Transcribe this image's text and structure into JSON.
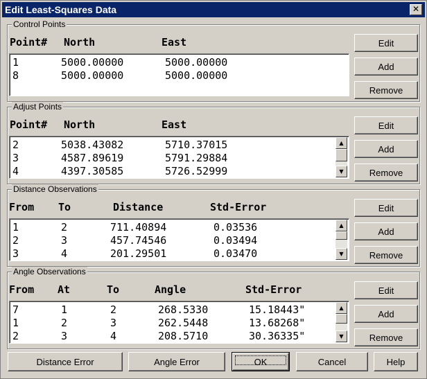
{
  "window": {
    "title": "Edit Least-Squares Data",
    "close_glyph": "✕"
  },
  "groups": {
    "control": {
      "label": "Control Points",
      "headers": [
        "Point#",
        "North",
        "East"
      ],
      "rows": [
        [
          "1",
          "5000.00000",
          "5000.00000"
        ],
        [
          "8",
          "5000.00000",
          "5000.00000"
        ]
      ],
      "buttons": [
        "Edit",
        "Add",
        "Remove"
      ]
    },
    "adjust": {
      "label": "Adjust Points",
      "headers": [
        "Point#",
        "North",
        "East"
      ],
      "rows": [
        [
          "2",
          "5038.43082",
          "5710.37015"
        ],
        [
          "3",
          "4587.89619",
          "5791.29884"
        ],
        [
          "4",
          "4397.30585",
          "5726.52999"
        ]
      ],
      "buttons": [
        "Edit",
        "Add",
        "Remove"
      ]
    },
    "distance": {
      "label": "Distance Observations",
      "headers": [
        "From",
        "To",
        "Distance",
        "Std-Error"
      ],
      "rows": [
        [
          "1",
          "2",
          "711.40894",
          "0.03536"
        ],
        [
          "2",
          "3",
          "457.74546",
          "0.03494"
        ],
        [
          "3",
          "4",
          "201.29501",
          "0.03470"
        ]
      ],
      "buttons": [
        "Edit",
        "Add",
        "Remove"
      ]
    },
    "angle": {
      "label": "Angle Observations",
      "headers": [
        "From",
        "At",
        "To",
        "Angle",
        "Std-Error"
      ],
      "rows": [
        [
          "7",
          "1",
          "2",
          "268.5330",
          "15.18443\""
        ],
        [
          "1",
          "2",
          "3",
          "262.5448",
          "13.68268\""
        ],
        [
          "2",
          "3",
          "4",
          "208.5710",
          "30.36335\""
        ]
      ],
      "buttons": [
        "Edit",
        "Add",
        "Remove"
      ]
    }
  },
  "bottom_buttons": {
    "distance_error": "Distance Error",
    "angle_error": "Angle Error",
    "ok": "OK",
    "cancel": "Cancel",
    "help": "Help"
  }
}
